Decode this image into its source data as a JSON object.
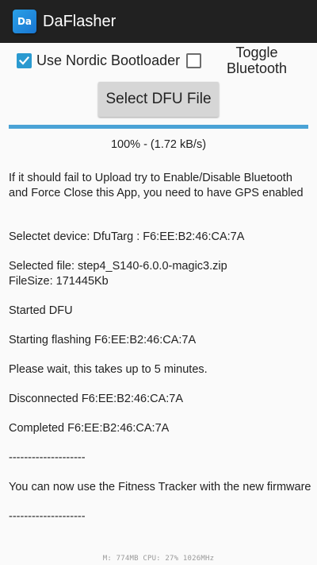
{
  "app_bar": {
    "icon_text": "Da",
    "title": "DaFlasher"
  },
  "controls": {
    "nordic_label": "Use Nordic Bootloader",
    "nordic_checked": true,
    "bluetooth_label": "Toggle Bluetooth",
    "bluetooth_checked": false,
    "select_button": "Select DFU File"
  },
  "progress": {
    "percent": 100,
    "text": "100% - (1.72 kB/s)"
  },
  "log": [
    "If it should fail to Upload try to Enable/Disable Bluetooth and Force Close this App, you need to have GPS enabled",
    "",
    "",
    "Selectet device: DfuTarg : F6:EE:B2:46:CA:7A",
    "",
    "Selected file: step4_S140-6.0.0-magic3.zip",
    "FileSize: 171445Kb",
    "",
    "Started DFU",
    "",
    "Starting flashing F6:EE:B2:46:CA:7A",
    "",
    "Please wait, this takes up to 5 minutes.",
    "",
    "Disconnected F6:EE:B2:46:CA:7A",
    "",
    "Completed F6:EE:B2:46:CA:7A",
    "",
    "--------------------",
    "",
    "You can now use the Fitness Tracker with the new firmware",
    "",
    "--------------------"
  ],
  "footer": {
    "stats": "M: 774MB CPU: 27% 1026MHz"
  },
  "colors": {
    "app_bar": "#212121",
    "accent": "#2a9ad0",
    "progress_fill": "#4aa3d6",
    "button_bg": "#d6d6d6"
  }
}
